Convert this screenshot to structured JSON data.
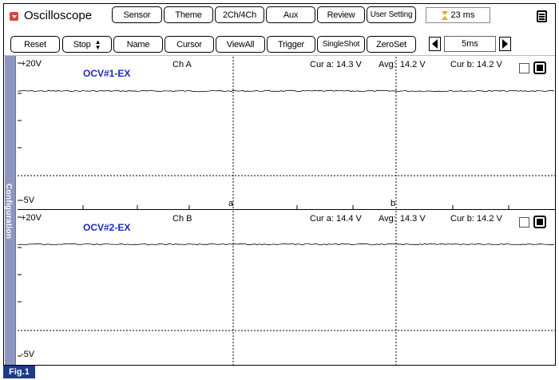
{
  "header": {
    "app_title": "Oscilloscope",
    "tabs": [
      "Sensor",
      "Theme",
      "2Ch/4Ch",
      "Aux",
      "Review",
      "User Setting"
    ],
    "time_display": "23 ms",
    "time_icon": "hourglass-icon",
    "menu_icon": "hamburger-menu-icon"
  },
  "toolbar": {
    "reset": "Reset",
    "stop": "Stop",
    "name": "Name",
    "cursor": "Cursor",
    "viewall": "ViewAll",
    "trigger": "Trigger",
    "singleshot": "SingleShot",
    "zeroset": "ZeroSet",
    "timebase": "5ms"
  },
  "sidebar": {
    "label": "Configuration"
  },
  "channels": [
    {
      "name": "OCV#1-EX",
      "ch": "Ch A",
      "vmax": "+20V",
      "vmin": "-5V",
      "cur_a_label": "Cur a:",
      "cur_a": "14.3 V",
      "avg_label": "Avg:",
      "avg": "14.2 V",
      "cur_b_label": "Cur b:",
      "cur_b": "14.2 V",
      "marker_a": "a",
      "marker_b": "b"
    },
    {
      "name": "OCV#2-EX",
      "ch": "Ch B",
      "vmax": "+20V",
      "vmin": "-5V",
      "cur_a_label": "Cur a:",
      "cur_a": "14.4 V",
      "avg_label": "Avg:",
      "avg": "14.3 V",
      "cur_b_label": "Cur b:",
      "cur_b": "14.2 V"
    }
  ],
  "figure_label": "Fig.1",
  "colors": {
    "channel_name": "#1a29c9",
    "sidebar": "#8d96c0",
    "fig_badge": "#1a3a8c",
    "menu_icon": "#d9473a"
  }
}
